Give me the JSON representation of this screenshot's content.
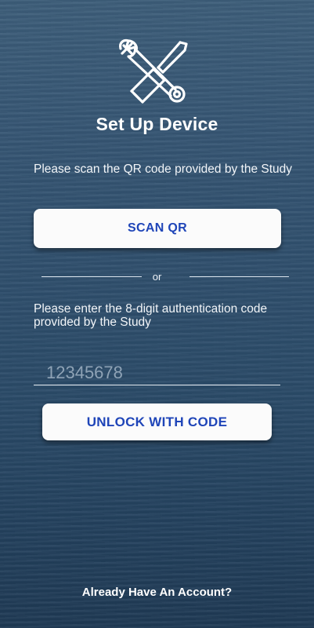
{
  "header": {
    "logo_icon": "wrench-screwdriver-icon",
    "title": "Set Up Device"
  },
  "qr_section": {
    "instruction": "Please scan the QR code provided by the Study",
    "scan_button_label": "SCAN QR"
  },
  "divider": {
    "label": "or"
  },
  "code_section": {
    "instruction": "Please enter the 8-digit authentication code provided by the Study",
    "input_placeholder": "12345678",
    "input_value": "",
    "unlock_button_label": "UNLOCK WITH CODE"
  },
  "footer": {
    "account_link": "Already Have An Account?"
  },
  "colors": {
    "button_text": "#1f45b8",
    "button_bg": "#fbfbfb",
    "background": "#2f4f6d"
  }
}
